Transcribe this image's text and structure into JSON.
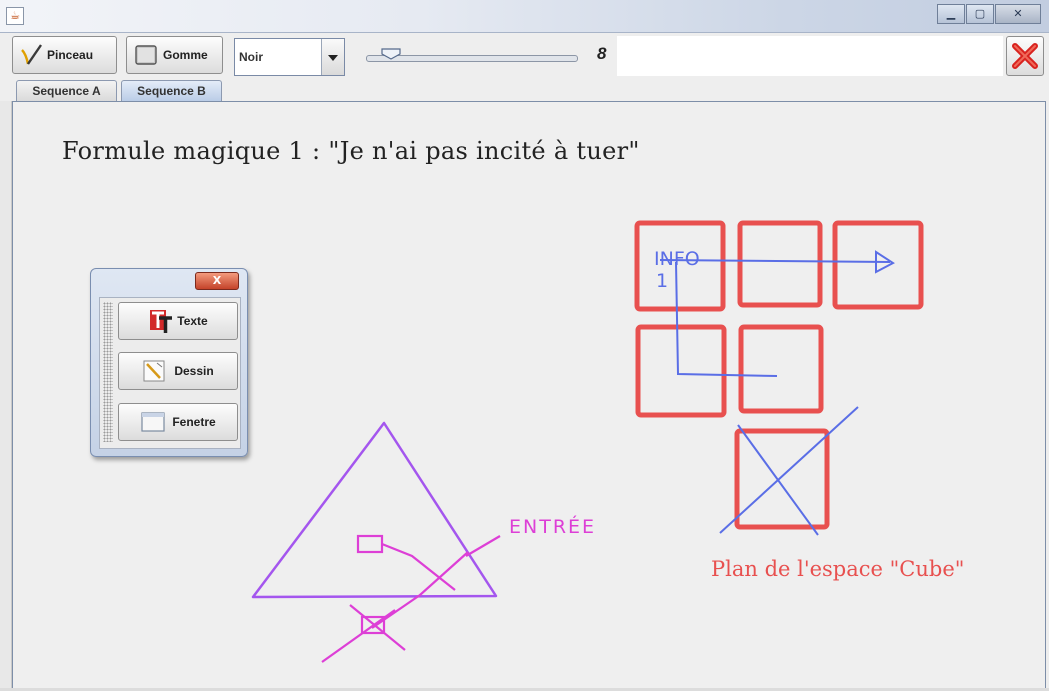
{
  "window": {
    "app_icon": "java-icon"
  },
  "toolbar": {
    "pinceau_label": "Pinceau",
    "gomme_label": "Gomme",
    "color_select_value": "Noir",
    "brush_size": "8",
    "brush_size_fraction": 0.1
  },
  "tabs": [
    {
      "label": "Sequence A",
      "active": false
    },
    {
      "label": "Sequence B",
      "active": true
    }
  ],
  "canvas": {
    "formula_text": "Formule magique 1 : \"Je n'ai pas incité à tuer\"",
    "info_label_line1": "INFO",
    "info_label_line2": "1",
    "entree_label": "ENTRÉE",
    "plan_label": "Plan de l'espace \"Cube\"",
    "colors": {
      "red": "#e8504f",
      "blue": "#5a6ee6",
      "purple": "#a456ee",
      "magenta": "#dd3fd6"
    }
  },
  "palette": {
    "close_glyph": "X",
    "texte_label": "Texte",
    "dessin_label": "Dessin",
    "fenetre_label": "Fenetre"
  }
}
